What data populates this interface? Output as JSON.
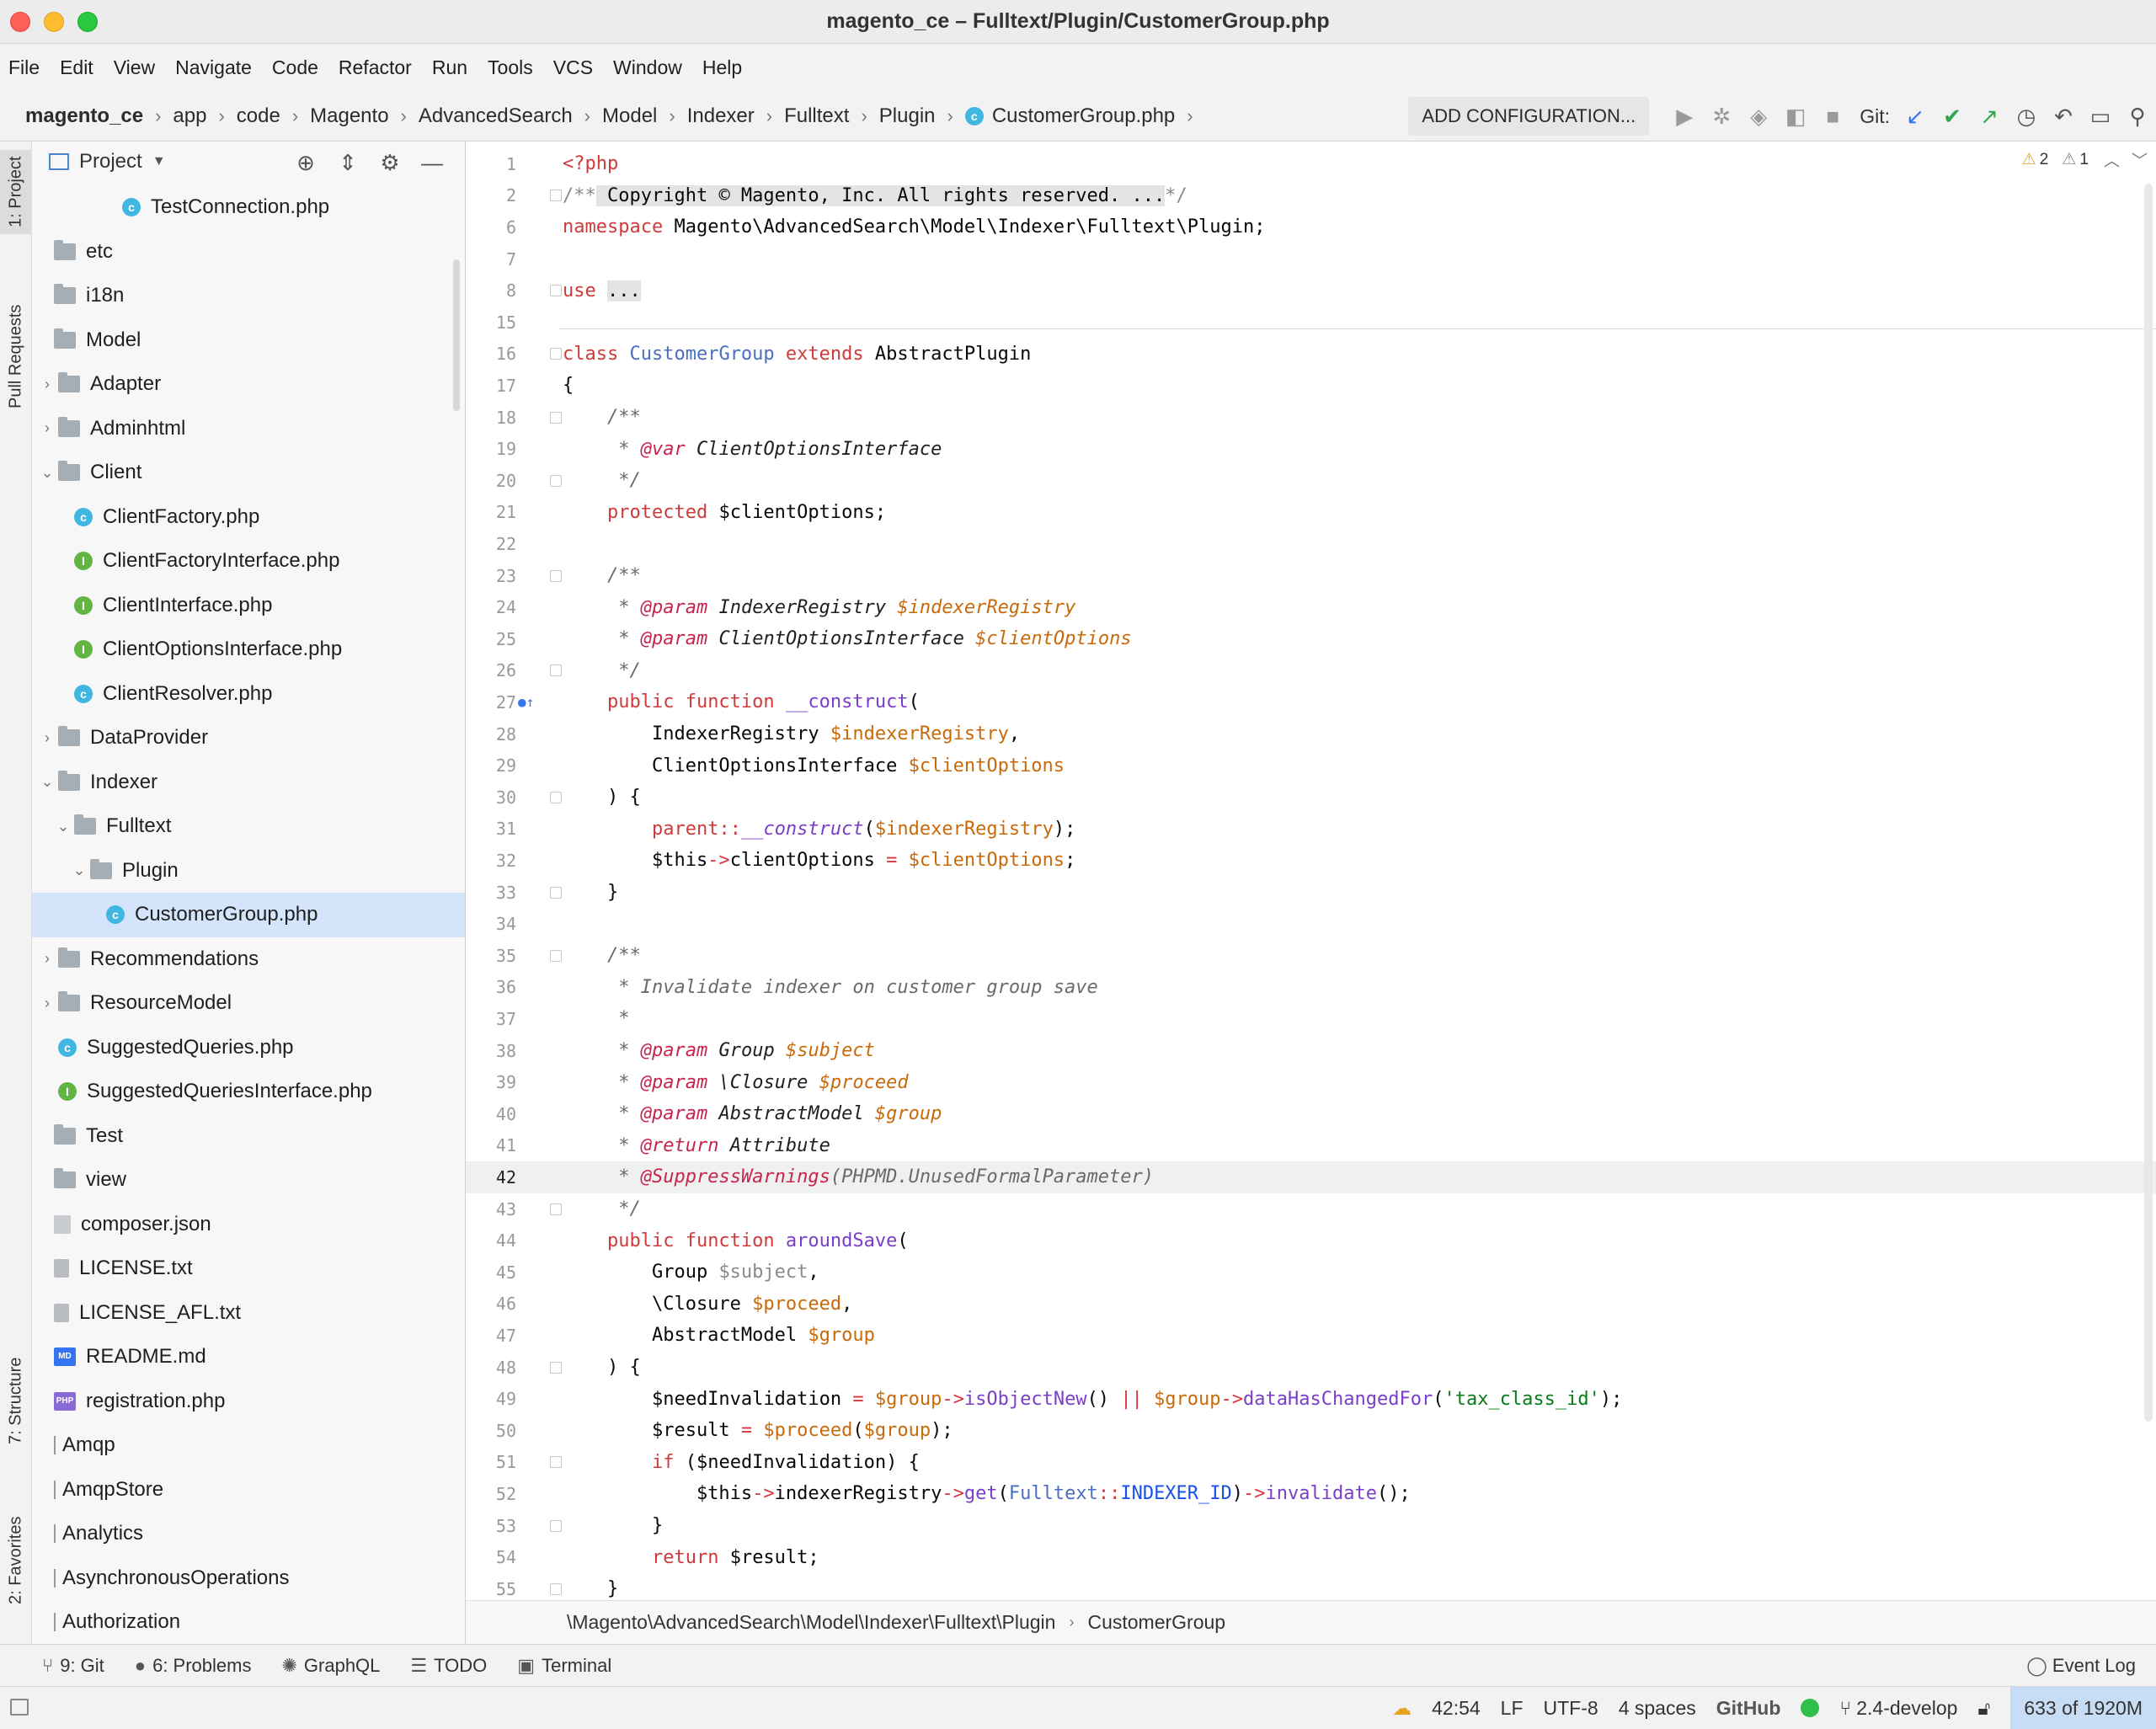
{
  "window": {
    "title": "magento_ce – Fulltext/Plugin/CustomerGroup.php"
  },
  "menu": [
    "File",
    "Edit",
    "View",
    "Navigate",
    "Code",
    "Refactor",
    "Run",
    "Tools",
    "VCS",
    "Window",
    "Help"
  ],
  "breadcrumb": [
    "magento_ce",
    "app",
    "code",
    "Magento",
    "AdvancedSearch",
    "Model",
    "Indexer",
    "Fulltext",
    "Plugin",
    "CustomerGroup.php"
  ],
  "toolbar": {
    "add_configuration": "ADD CONFIGURATION...",
    "git_label": "Git:"
  },
  "left_strip": {
    "project_tab": "1: Project",
    "pull_requests_tab": "Pull Requests",
    "structure_tab": "7: Structure",
    "favorites_tab": "2: Favorites"
  },
  "project_panel": {
    "title": "Project",
    "tree": [
      {
        "label": "TestConnection.php",
        "icon": "php-class",
        "indent": 5,
        "arrow": ""
      },
      {
        "label": "etc",
        "icon": "folder",
        "indent": 0,
        "arrow": ""
      },
      {
        "label": "i18n",
        "icon": "folder",
        "indent": 0,
        "arrow": ""
      },
      {
        "label": "Model",
        "icon": "folder",
        "indent": 0,
        "arrow": ""
      },
      {
        "label": "Adapter",
        "icon": "folder",
        "indent": 1,
        "arrow": "›"
      },
      {
        "label": "Adminhtml",
        "icon": "folder",
        "indent": 1,
        "arrow": "›"
      },
      {
        "label": "Client",
        "icon": "folder",
        "indent": 1,
        "arrow": "⌄"
      },
      {
        "label": "ClientFactory.php",
        "icon": "php-class",
        "indent": 2,
        "arrow": ""
      },
      {
        "label": "ClientFactoryInterface.php",
        "icon": "php-interface",
        "indent": 2,
        "arrow": ""
      },
      {
        "label": "ClientInterface.php",
        "icon": "php-interface",
        "indent": 2,
        "arrow": ""
      },
      {
        "label": "ClientOptionsInterface.php",
        "icon": "php-interface",
        "indent": 2,
        "arrow": ""
      },
      {
        "label": "ClientResolver.php",
        "icon": "php-class",
        "indent": 2,
        "arrow": ""
      },
      {
        "label": "DataProvider",
        "icon": "folder",
        "indent": 1,
        "arrow": "›"
      },
      {
        "label": "Indexer",
        "icon": "folder",
        "indent": 1,
        "arrow": "⌄"
      },
      {
        "label": "Fulltext",
        "icon": "folder",
        "indent": 2,
        "arrow": "⌄"
      },
      {
        "label": "Plugin",
        "icon": "folder",
        "indent": 3,
        "arrow": "⌄"
      },
      {
        "label": "CustomerGroup.php",
        "icon": "php-class",
        "indent": 4,
        "arrow": "",
        "selected": true
      },
      {
        "label": "Recommendations",
        "icon": "folder",
        "indent": 1,
        "arrow": "›"
      },
      {
        "label": "ResourceModel",
        "icon": "folder",
        "indent": 1,
        "arrow": "›"
      },
      {
        "label": "SuggestedQueries.php",
        "icon": "php-class",
        "indent": 1,
        "arrow": ""
      },
      {
        "label": "SuggestedQueriesInterface.php",
        "icon": "php-interface",
        "indent": 1,
        "arrow": ""
      },
      {
        "label": "Test",
        "icon": "folder",
        "indent": 0,
        "arrow": ""
      },
      {
        "label": "view",
        "icon": "folder",
        "indent": 0,
        "arrow": ""
      },
      {
        "label": "composer.json",
        "icon": "json",
        "indent": 0,
        "arrow": ""
      },
      {
        "label": "LICENSE.txt",
        "icon": "text",
        "indent": 0,
        "arrow": ""
      },
      {
        "label": "LICENSE_AFL.txt",
        "icon": "text",
        "indent": 0,
        "arrow": ""
      },
      {
        "label": "README.md",
        "icon": "markdown",
        "indent": 0,
        "arrow": ""
      },
      {
        "label": "registration.php",
        "icon": "php-file",
        "indent": 0,
        "arrow": ""
      },
      {
        "label": "Amqp",
        "icon": "module",
        "indent": -1,
        "arrow": ""
      },
      {
        "label": "AmqpStore",
        "icon": "module",
        "indent": -1,
        "arrow": ""
      },
      {
        "label": "Analytics",
        "icon": "module",
        "indent": -1,
        "arrow": ""
      },
      {
        "label": "AsynchronousOperations",
        "icon": "module",
        "indent": -1,
        "arrow": ""
      },
      {
        "label": "Authorization",
        "icon": "module",
        "indent": -1,
        "arrow": ""
      }
    ]
  },
  "editor": {
    "warnings": {
      "warnings": "2",
      "weak_warnings": "1"
    },
    "current_line": "42",
    "lines": [
      {
        "n": "1",
        "html": "<span class='kw'>&lt;?php</span>"
      },
      {
        "n": "2",
        "html": "<span class='gray'>/**</span><span class='folded'> Copyright © Magento, Inc. All rights reserved. ...</span><span class='gray'>*/</span>",
        "fold": true
      },
      {
        "n": "6",
        "html": "<span class='kw'>namespace</span> Magento\\AdvancedSearch\\Model\\Indexer\\Fulltext\\Plugin;"
      },
      {
        "n": "7",
        "html": ""
      },
      {
        "n": "8",
        "html": "<span class='kw'>use</span> <span class='folded'>...</span>",
        "fold": true
      },
      {
        "n": "15",
        "html": ""
      },
      {
        "n": "16",
        "html": "<span class='kw'>class</span> <span class='cls'>CustomerGroup</span> <span class='kw'>extends</span> AbstractPlugin",
        "fold": true
      },
      {
        "n": "17",
        "html": "{"
      },
      {
        "n": "18",
        "html": "    <span class='cm'>/**</span>",
        "fold": true
      },
      {
        "n": "19",
        "html": "     <span class='cm'>* </span><span class='tag'>@var</span> <span class='ty'>ClientOptionsInterface</span>"
      },
      {
        "n": "20",
        "html": "     <span class='cm'>*/</span>",
        "fold": true
      },
      {
        "n": "21",
        "html": "    <span class='kw'>protected</span> $clientOptions;"
      },
      {
        "n": "22",
        "html": ""
      },
      {
        "n": "23",
        "html": "    <span class='cm'>/**</span>",
        "fold": true
      },
      {
        "n": "24",
        "html": "     <span class='cm'>* </span><span class='tag'>@param</span> <span class='ty'>IndexerRegistry</span> <span class='vr' style='font-style:italic'>$indexerRegistry</span>"
      },
      {
        "n": "25",
        "html": "     <span class='cm'>* </span><span class='tag'>@param</span> <span class='ty'>ClientOptionsInterface</span> <span class='vr' style='font-style:italic'>$clientOptions</span>"
      },
      {
        "n": "26",
        "html": "     <span class='cm'>*/</span>",
        "fold": true
      },
      {
        "n": "27",
        "html": "    <span class='kw'>public function</span> <span class='fn'>__construct</span>(",
        "marker": true
      },
      {
        "n": "28",
        "html": "        IndexerRegistry <span class='vr'>$indexerRegistry</span>,"
      },
      {
        "n": "29",
        "html": "        ClientOptionsInterface <span class='vr'>$clientOptions</span>"
      },
      {
        "n": "30",
        "html": "    ) {",
        "fold": true
      },
      {
        "n": "31",
        "html": "        <span class='kw'>parent</span><span class='op'>::</span><span class='fn' style='font-style:italic'>__construct</span>(<span class='vr'>$indexerRegistry</span>);"
      },
      {
        "n": "32",
        "html": "        $this<span class='op'>-&gt;</span>clientOptions <span class='op'>=</span> <span class='vr'>$clientOptions</span>;"
      },
      {
        "n": "33",
        "html": "    }",
        "fold": true
      },
      {
        "n": "34",
        "html": ""
      },
      {
        "n": "35",
        "html": "    <span class='cm'>/**</span>",
        "fold": true
      },
      {
        "n": "36",
        "html": "     <span class='cm'>* Invalidate indexer on customer group save</span>"
      },
      {
        "n": "37",
        "html": "     <span class='cm'>*</span>"
      },
      {
        "n": "38",
        "html": "     <span class='cm'>* </span><span class='tag'>@param</span> <span class='ty'>Group</span> <span class='vr' style='font-style:italic'>$subject</span>"
      },
      {
        "n": "39",
        "html": "     <span class='cm'>* </span><span class='tag'>@param</span> <span class='ty'>\\Closure</span> <span class='vr' style='font-style:italic'>$proceed</span>"
      },
      {
        "n": "40",
        "html": "     <span class='cm'>* </span><span class='tag'>@param</span> <span class='ty'>AbstractModel</span> <span class='vr' style='font-style:italic'>$group</span>"
      },
      {
        "n": "41",
        "html": "     <span class='cm'>* </span><span class='tag'>@return</span> <span class='ty'>Attribute</span>"
      },
      {
        "n": "42",
        "html": "     <span class='cm'>* </span><span class='tag'>@SuppressWarnings</span><span class='cm'>(PHPMD.UnusedFormalParameter)</span>",
        "current": true
      },
      {
        "n": "43",
        "html": "     <span class='cm'>*/</span>",
        "fold": true
      },
      {
        "n": "44",
        "html": "    <span class='kw'>public function</span> <span class='fn'>aroundSave</span>("
      },
      {
        "n": "45",
        "html": "        Group <span class='gray'>$subject</span>,"
      },
      {
        "n": "46",
        "html": "        \\Closure <span class='vr'>$proceed</span>,"
      },
      {
        "n": "47",
        "html": "        AbstractModel <span class='vr'>$group</span>"
      },
      {
        "n": "48",
        "html": "    ) {",
        "fold": true
      },
      {
        "n": "49",
        "html": "        $needInvalidation <span class='op'>=</span> <span class='vr'>$group</span><span class='op'>-&gt;</span><span class='fn'>isObjectNew</span>() <span class='op'>||</span> <span class='vr'>$group</span><span class='op'>-&gt;</span><span class='fn'>dataHasChangedFor</span>(<span class='str'>'tax_class_id'</span>);"
      },
      {
        "n": "50",
        "html": "        $result <span class='op'>=</span> <span class='vr'>$proceed</span>(<span class='vr'>$group</span>);"
      },
      {
        "n": "51",
        "html": "        <span class='kw'>if</span> ($needInvalidation) {",
        "fold": true
      },
      {
        "n": "52",
        "html": "            $this<span class='op'>-&gt;</span>indexerRegistry<span class='op'>-&gt;</span><span class='fn'>get</span>(<span class='cls'>Fulltext</span><span class='op'>::</span><span class='const'>INDEXER_ID</span>)<span class='op'>-&gt;</span><span class='fn'>invalidate</span>();"
      },
      {
        "n": "53",
        "html": "        }",
        "fold": true
      },
      {
        "n": "54",
        "html": "        <span class='kw'>return</span> $result;"
      },
      {
        "n": "55",
        "html": "    }",
        "fold": true
      }
    ]
  },
  "editor_breadcrumb": {
    "namespace": "\\Magento\\AdvancedSearch\\Model\\Indexer\\Fulltext\\Plugin",
    "class": "CustomerGroup"
  },
  "bottom_tools": {
    "git": "9: Git",
    "problems": "6: Problems",
    "graphql": "GraphQL",
    "todo": "TODO",
    "terminal": "Terminal",
    "event_log": "Event Log"
  },
  "statusbar": {
    "position": "42:54",
    "line_sep": "LF",
    "encoding": "UTF-8",
    "indent": "4 spaces",
    "github": "GitHub",
    "branch": "2.4-develop",
    "memory": "633 of 1920M"
  }
}
